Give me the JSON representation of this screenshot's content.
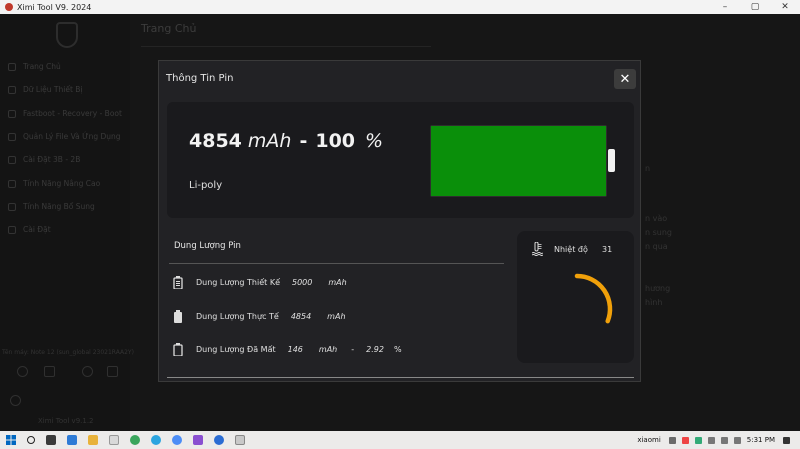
{
  "window": {
    "title": "Ximi Tool V9. 2024",
    "controls": [
      "–",
      "▢",
      "✕"
    ]
  },
  "sidebar": {
    "items": [
      {
        "label": "Trang Chủ",
        "icon": "home-icon"
      },
      {
        "label": "Dữ Liệu Thiết Bị",
        "icon": "device-icon"
      },
      {
        "label": "Fastboot - Recovery - Boot",
        "icon": "boot-icon"
      },
      {
        "label": "Quản Lý File Và Ứng Dụng",
        "icon": "folder-icon"
      },
      {
        "label": "Cài Đặt 3B - 2B",
        "icon": "install-icon"
      },
      {
        "label": "Tính Năng Nâng Cao",
        "icon": "advanced-icon"
      },
      {
        "label": "Tính Năng Bổ Sung",
        "icon": "extra-icon"
      },
      {
        "label": "Cài Đặt",
        "icon": "settings-icon"
      }
    ],
    "device_line": "Tên máy: Note 12 (sun_global 23021RAA2Y)",
    "version": "Ximi Tool v9.1.2"
  },
  "main": {
    "title": "Trang Chủ"
  },
  "dialog": {
    "title": "Thông Tin Pin",
    "close_icon": "close-icon",
    "capacity_value": "4854",
    "capacity_unit": "mAh",
    "separator": "-",
    "percent_value": "100",
    "percent_unit": "%",
    "chemistry": "Li-poly",
    "battery_level": 1.0,
    "battery_color": "#0a8f0a",
    "section_title": "Dung Lượng Pin",
    "rows": [
      {
        "label": "Dung Lượng Thiết Kế",
        "value": "5000",
        "unit": "mAh"
      },
      {
        "label": "Dung Lượng Thực Tế",
        "value": "4854",
        "unit": "mAh"
      },
      {
        "label": "Dung Lượng Đã Mất",
        "value": "146",
        "unit": "mAh",
        "sep": "-",
        "pct": "2.92",
        "pct_unit": "%"
      }
    ],
    "temperature": {
      "label": "Nhiệt độ",
      "value": "31",
      "gauge_level": 0.31,
      "gauge_color": "#f0a00a"
    }
  },
  "taskbar": {
    "tray_text": "xiaomi",
    "time": "5:31 PM",
    "accent": "#0067c0"
  }
}
